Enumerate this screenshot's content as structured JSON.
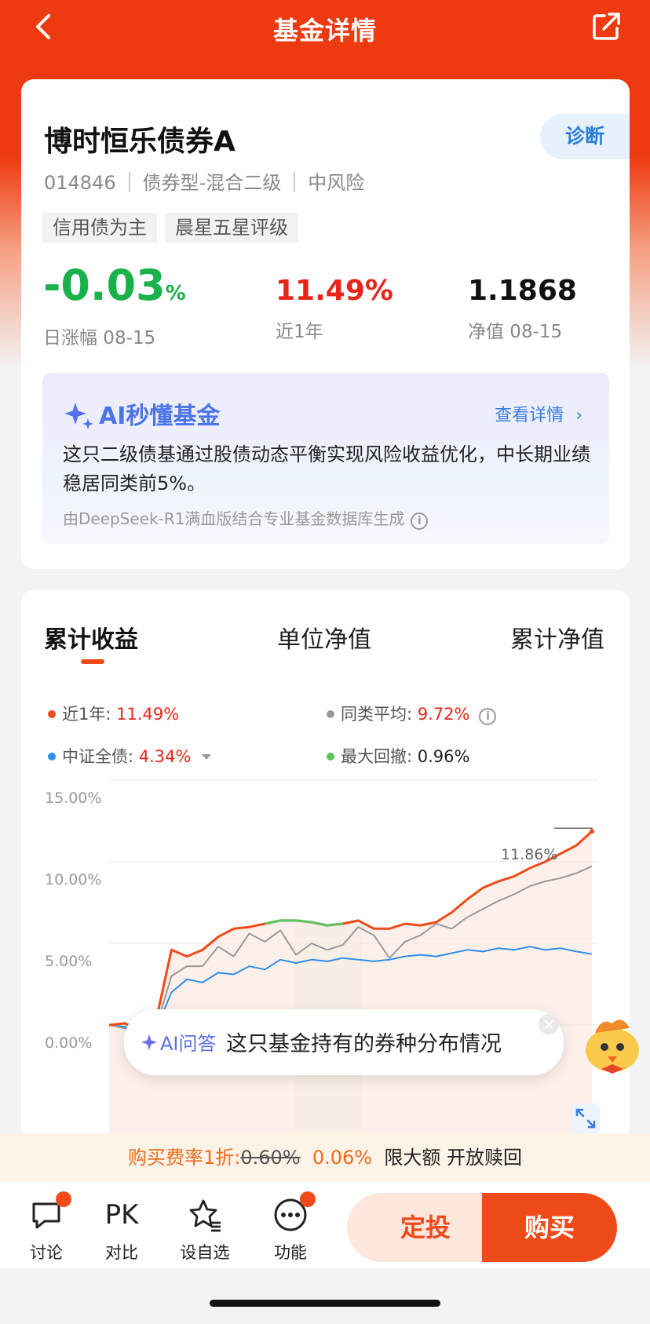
{
  "header": {
    "title": "基金详情"
  },
  "fund": {
    "name": "博时恒乐债券A",
    "diagnose_label": "诊断",
    "code": "014846",
    "category": "债券型-混合二级",
    "risk": "中风险",
    "tags": [
      "信用债为主",
      "晨星五星评级"
    ]
  },
  "stats": {
    "daily_change": "-0.03",
    "daily_change_unit": "%",
    "daily_label": "日涨幅 08-15",
    "year_return": "11.49%",
    "year_label": "近1年",
    "nav": "1.1868",
    "nav_label": "净值 08-15"
  },
  "ai_summary": {
    "title": "AI秒懂基金",
    "more_label": "查看详情",
    "text": "这只二级债基通过股债动态平衡实现风险收益优化，中长期业绩稳居同类前5%。",
    "footnote": "由DeepSeek-R1满血版结合专业基金数据库生成"
  },
  "chart_tabs": [
    "累计收益",
    "单位净值",
    "累计净值"
  ],
  "legend": [
    {
      "label": "近1年:",
      "value": "11.49%",
      "color": "#f04a1a",
      "value_style": "red"
    },
    {
      "label": "同类平均:",
      "value": "9.72%",
      "color": "#999999",
      "value_style": "red"
    },
    {
      "label": "中证全债:",
      "value": "4.34%",
      "color": "#2e8fe8",
      "value_style": "red"
    },
    {
      "label": "最大回撤:",
      "value": "0.96%",
      "color": "#5cc45c",
      "value_style": "dark"
    }
  ],
  "chart_data": {
    "type": "line",
    "ylim": [
      -2,
      15
    ],
    "yticks": [
      "15.00%",
      "10.00%",
      "5.00%",
      "0.00%"
    ],
    "end_label": "11.86%",
    "series": [
      {
        "name": "近1年",
        "color": "#f04a1a",
        "values": [
          0,
          0.1,
          -0.3,
          0.2,
          4.6,
          4.2,
          4.6,
          5.4,
          5.9,
          6.0,
          6.2,
          6.4,
          6.4,
          6.3,
          6.1,
          6.2,
          6.4,
          5.9,
          5.9,
          6.2,
          6.1,
          6.3,
          6.9,
          7.7,
          8.4,
          8.8,
          9.1,
          9.6,
          10.0,
          10.5,
          11.0,
          11.86
        ]
      },
      {
        "name": "同类平均",
        "color": "#999999",
        "values": [
          0,
          -0.2,
          -0.6,
          -0.2,
          3.0,
          3.6,
          3.6,
          4.8,
          4.2,
          5.6,
          5.1,
          5.8,
          4.3,
          5.0,
          4.6,
          4.9,
          6.0,
          5.5,
          4.1,
          5.1,
          5.5,
          6.2,
          5.9,
          6.6,
          7.1,
          7.6,
          8.0,
          8.5,
          8.8,
          9.0,
          9.3,
          9.72
        ]
      },
      {
        "name": "中证全债",
        "color": "#2e8fe8",
        "values": [
          0,
          -0.1,
          -0.5,
          -0.3,
          2.0,
          2.8,
          2.6,
          3.2,
          3.1,
          3.6,
          3.4,
          4.0,
          3.8,
          4.0,
          3.9,
          4.1,
          4.0,
          3.9,
          4.0,
          4.2,
          4.3,
          4.2,
          4.4,
          4.6,
          4.5,
          4.7,
          4.6,
          4.8,
          4.6,
          4.7,
          4.5,
          4.34
        ]
      }
    ]
  },
  "ai_ask": {
    "label": "AI问答",
    "question": "这只基金持有的券种分布情况"
  },
  "fee": {
    "prefix": "购买费率1折:",
    "original": "0.60%",
    "discounted": "0.06%",
    "tail": "限大额 开放赎回"
  },
  "bottom_nav": [
    {
      "label": "讨论",
      "icon": "chat-icon"
    },
    {
      "label": "对比",
      "icon": "pk-icon",
      "glyph": "PK"
    },
    {
      "label": "设自选",
      "icon": "star-list-icon"
    },
    {
      "label": "功能",
      "icon": "more-icon"
    }
  ],
  "actions": {
    "sip": "定投",
    "buy": "购买"
  }
}
